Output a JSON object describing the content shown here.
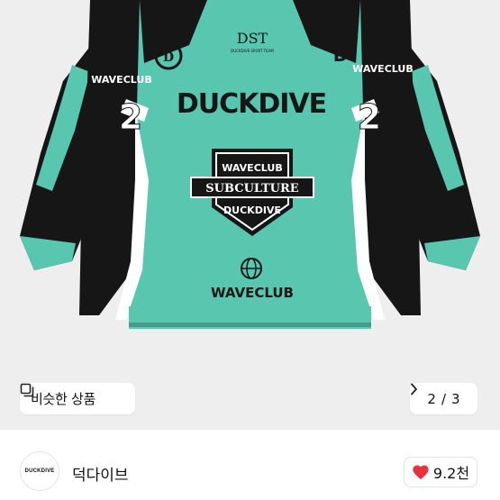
{
  "product": {
    "image_alt": "DUCKDIVE WAVECLUB jersey",
    "jersey_text": {
      "collar_brand": "DST",
      "chest_title": "DUCKDIVE",
      "sleeve_club": "WAVECLUB",
      "sleeve_number": "2",
      "crest_top": "WAVECLUB",
      "crest_middle": "SUBCULTURE",
      "crest_bottom": "DUCKDIVE",
      "bottom_club": "WAVECLUB"
    },
    "colors": {
      "mint": "#59c6b0",
      "black": "#161616",
      "background": "#eeeeef"
    }
  },
  "similar": {
    "label": "비슷한 상품",
    "icon": "similar-items-icon"
  },
  "pager": {
    "current": "2",
    "separator": "/",
    "total": "3",
    "icon": "chevron-right-icon"
  },
  "seller": {
    "name": "덕다이브",
    "logo_text": "DUCKDIVE"
  },
  "like": {
    "count": "9.2천",
    "icon": "heart-icon",
    "color": "#e8303f"
  }
}
